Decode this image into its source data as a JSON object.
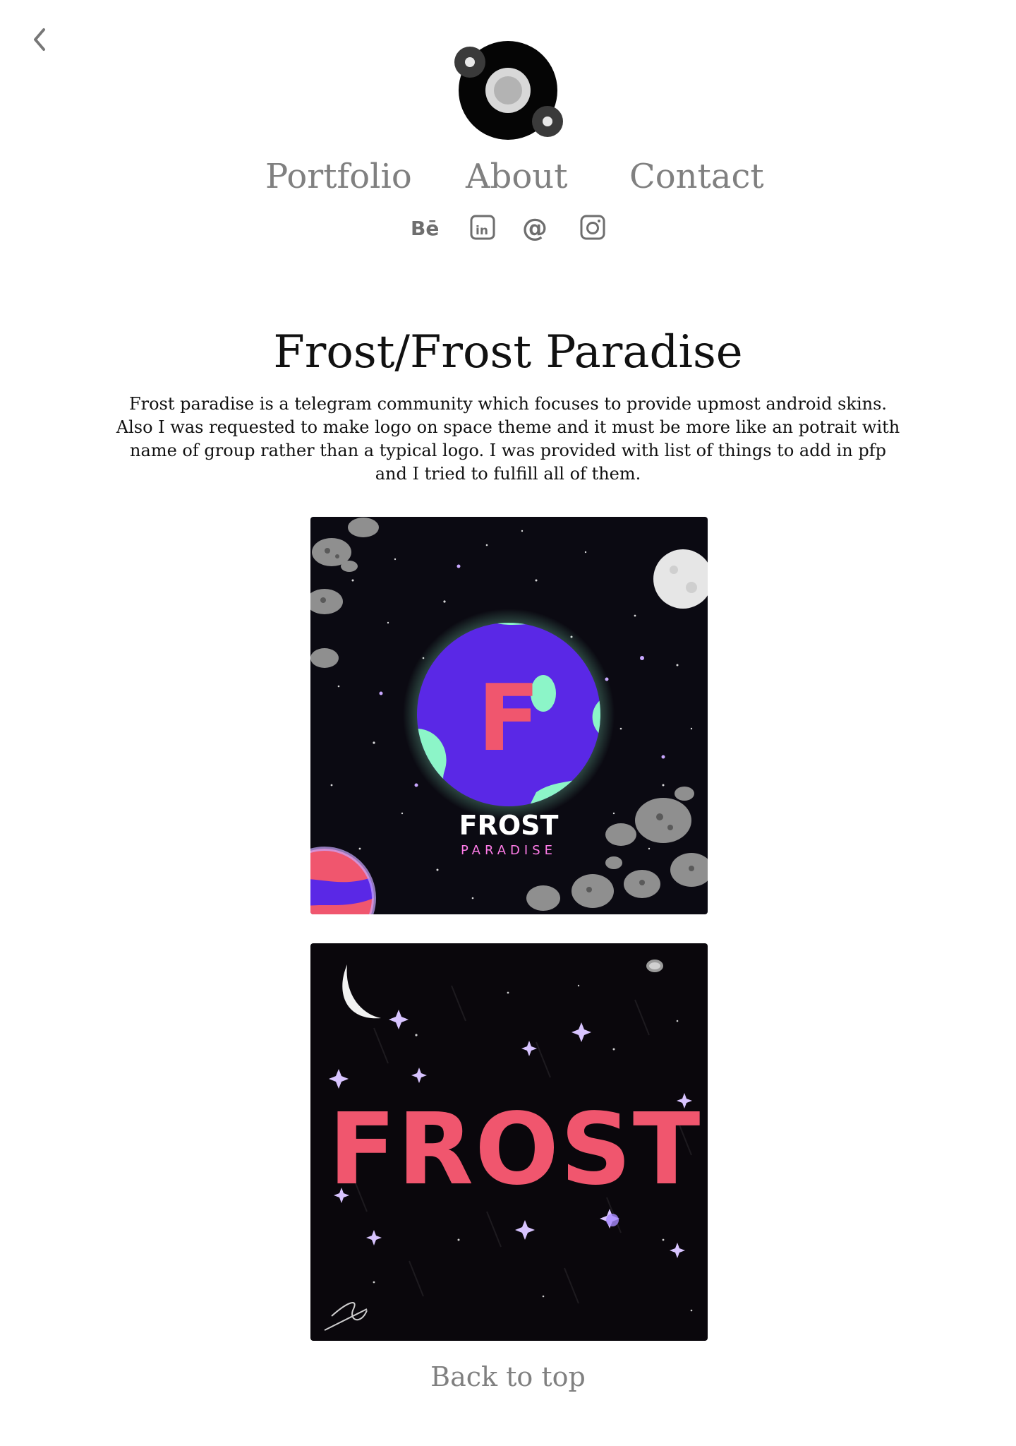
{
  "header": {
    "back_icon": "chevron-left-icon",
    "logo_icon": "planet-logo-icon"
  },
  "nav": {
    "items": [
      {
        "label": "Portfolio"
      },
      {
        "label": "About"
      },
      {
        "label": "Contact"
      }
    ]
  },
  "social": {
    "icons": [
      "behance-icon",
      "linkedin-icon",
      "email-icon",
      "instagram-icon"
    ]
  },
  "project": {
    "title": "Frost/Frost Paradise",
    "description": "Frost paradise is a telegram community which focuses to provide upmost android skins. Also I was requested to make logo on space theme and it must be more like an potrait with name of group rather than a typical logo. I was provided with list of things to add in pfp and I tried to fulfill all of them.",
    "artwork1": {
      "letter": "F",
      "name": "FROST",
      "subname": "PARADISE"
    },
    "artwork2": {
      "word": "FROST"
    }
  },
  "footer": {
    "back_to_top": "Back to top"
  },
  "colors": {
    "nav_text": "#808080",
    "text": "#111111",
    "space_bg": "#0b0a12",
    "planet_green": "#8cf5c8",
    "planet_purple": "#5a28e6",
    "coral": "#f0566e"
  }
}
